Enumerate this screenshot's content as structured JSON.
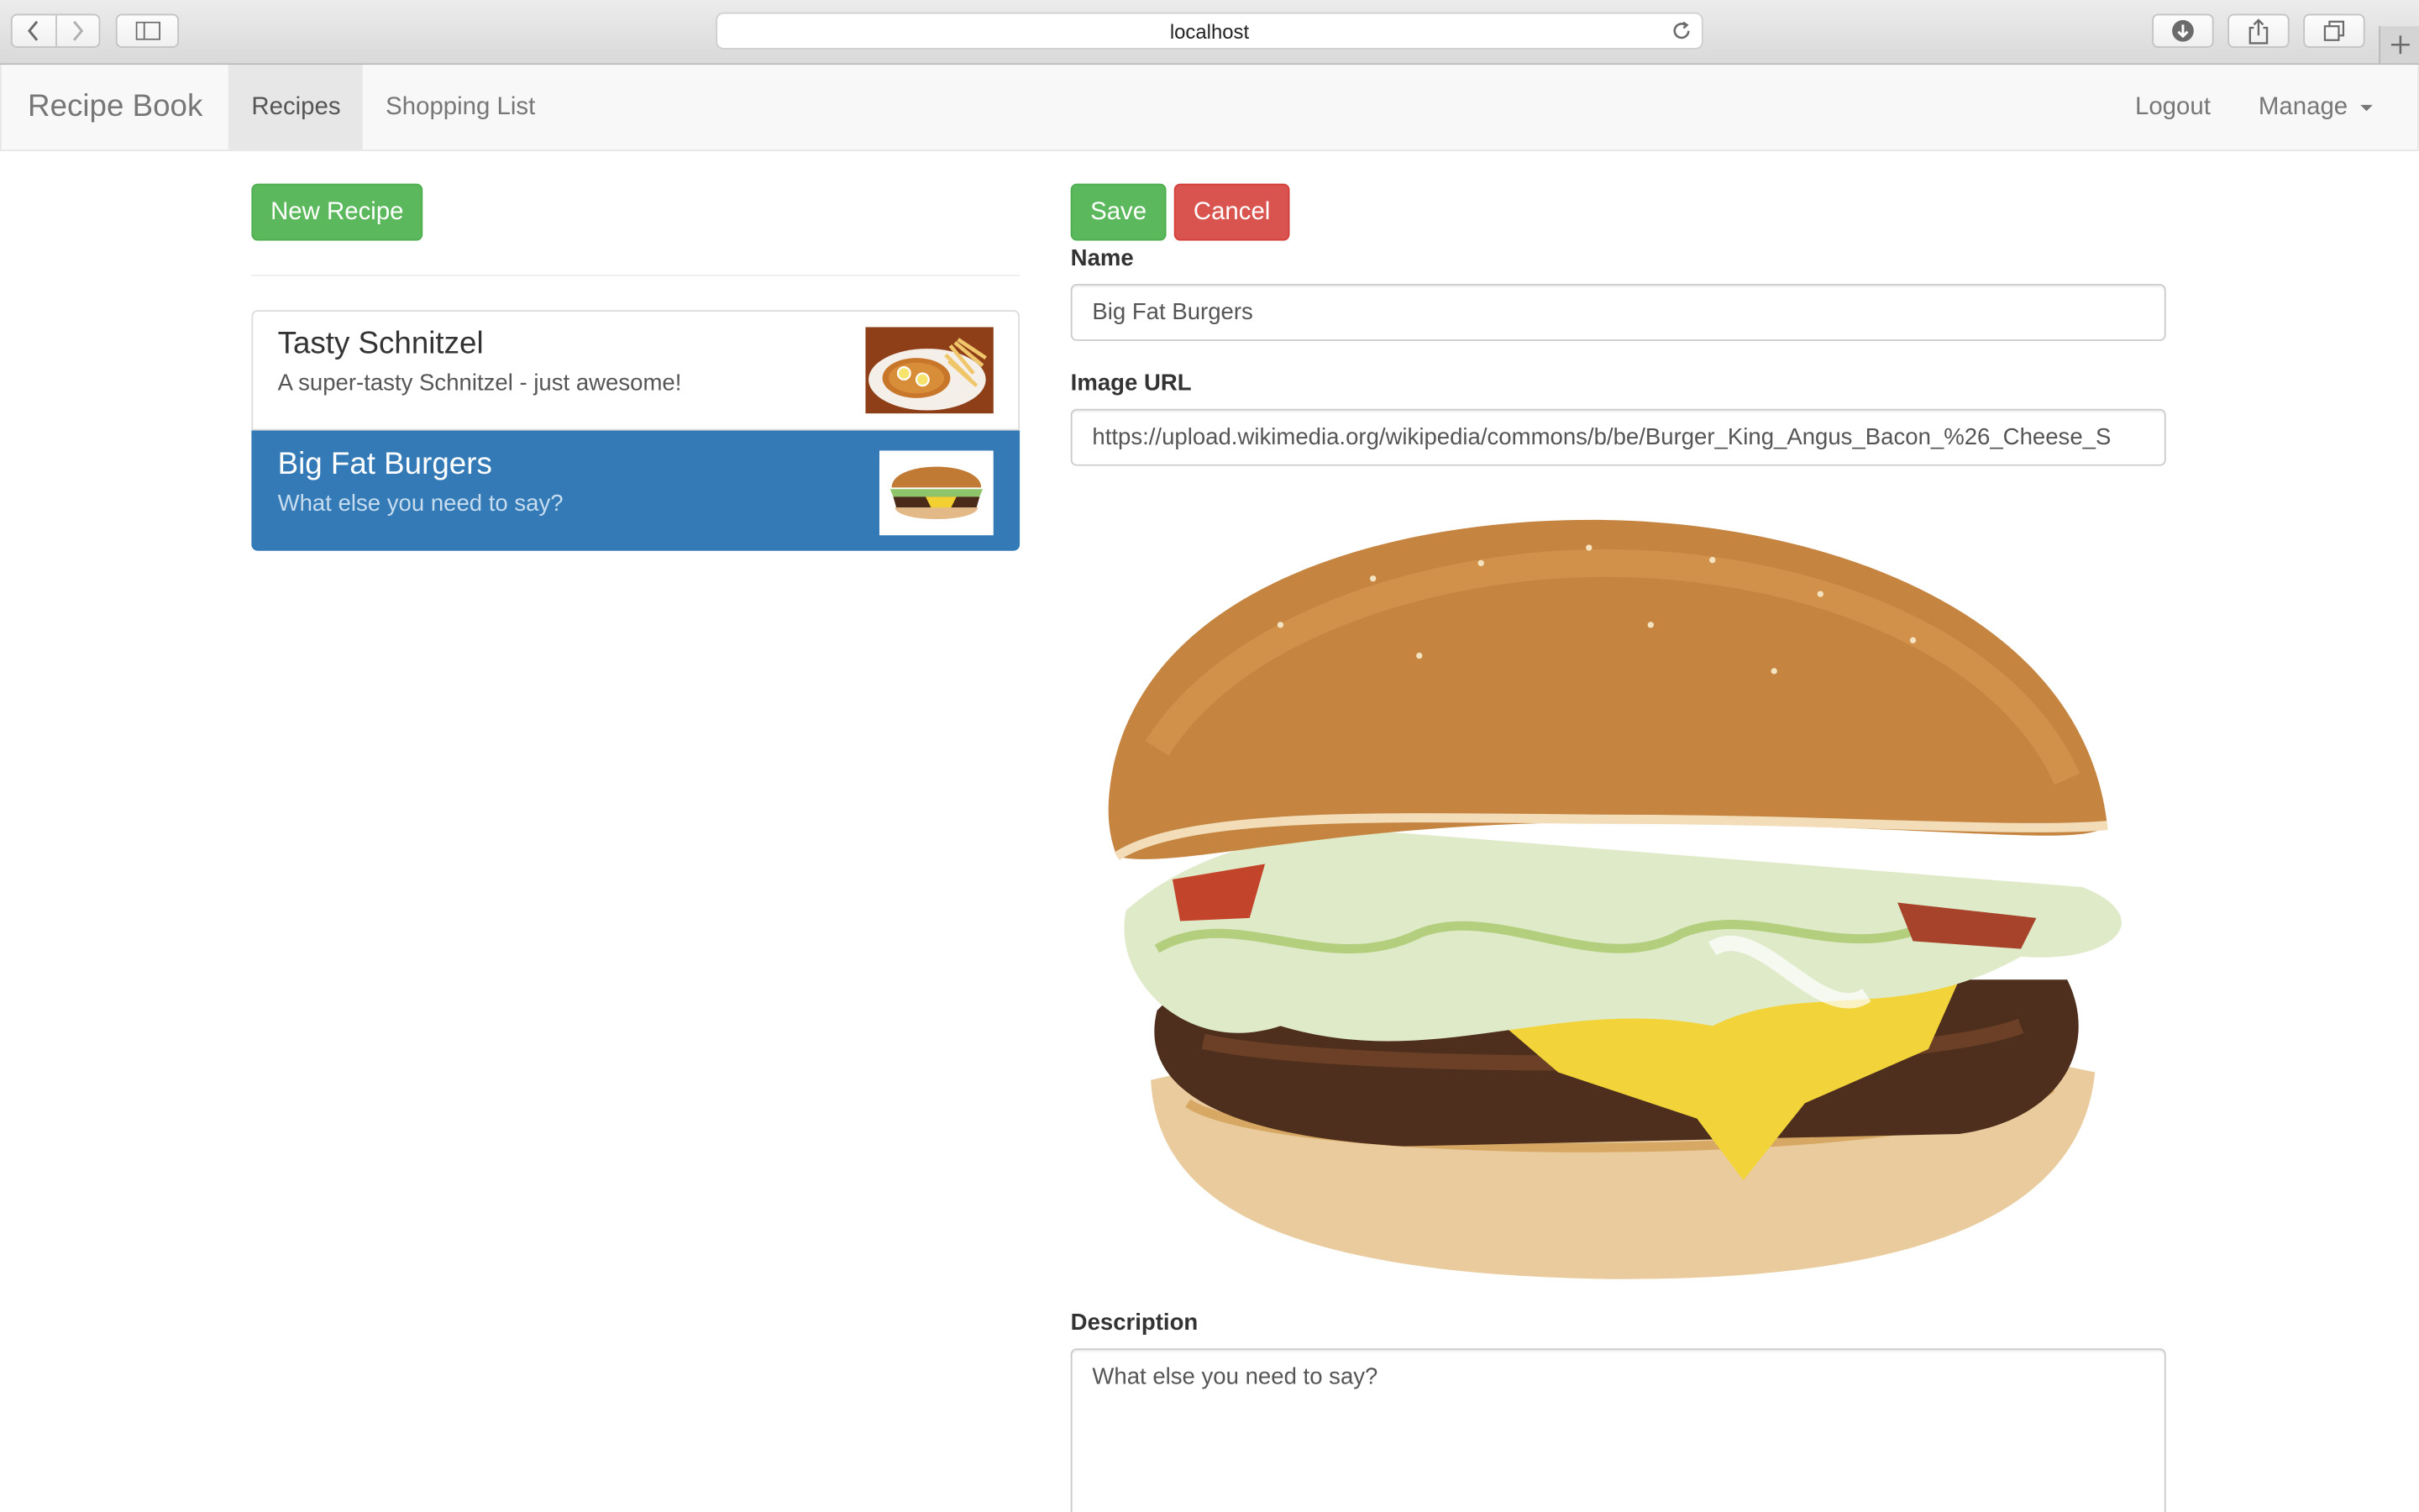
{
  "browser": {
    "url": "localhost",
    "icons": [
      "back-icon",
      "forward-icon",
      "sidebar-icon",
      "reload-icon",
      "download-icon",
      "share-icon",
      "tabs-icon",
      "new-tab-icon"
    ]
  },
  "navbar": {
    "brand": "Recipe Book",
    "links": [
      {
        "label": "Recipes",
        "active": true
      },
      {
        "label": "Shopping List",
        "active": false
      }
    ],
    "logout": "Logout",
    "manage": "Manage"
  },
  "sidebar": {
    "new_recipe_label": "New Recipe",
    "recipes": [
      {
        "name": "Tasty Schnitzel",
        "description": "A super-tasty Schnitzel - just awesome!",
        "active": false
      },
      {
        "name": "Big Fat Burgers",
        "description": "What else you need to say?",
        "active": true
      }
    ]
  },
  "editor": {
    "save_label": "Save",
    "cancel_label": "Cancel",
    "name_label": "Name",
    "name_value": "Big Fat Burgers",
    "image_url_label": "Image URL",
    "image_url_value": "https://upload.wikimedia.org/wikipedia/commons/b/be/Burger_King_Angus_Bacon_%26_Cheese_S",
    "description_label": "Description",
    "description_value": "What else you need to say?"
  },
  "colors": {
    "success": "#5cb85c",
    "danger": "#d9534f",
    "active_item": "#337ab7",
    "navbar_bg": "#f8f8f8"
  }
}
